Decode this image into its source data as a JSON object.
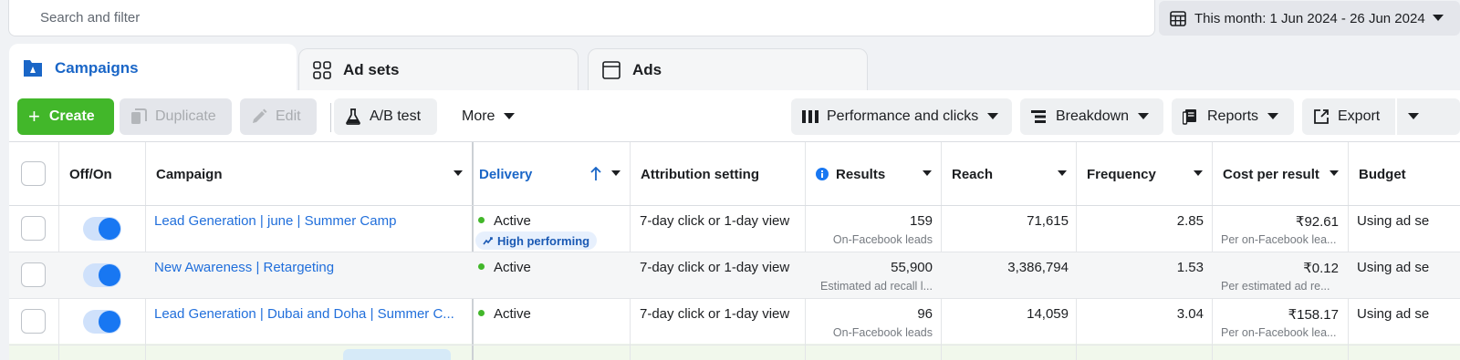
{
  "search": {
    "placeholder": "Search and filter"
  },
  "date_range": {
    "label": "This month: 1 Jun 2024 - 26 Jun 2024"
  },
  "tabs": [
    {
      "label": "Campaigns",
      "icon": "campaigns-icon",
      "active": true
    },
    {
      "label": "Ad sets",
      "icon": "ad-sets-icon",
      "active": false
    },
    {
      "label": "Ads",
      "icon": "ads-icon",
      "active": false
    }
  ],
  "toolbar": {
    "create": "Create",
    "duplicate": "Duplicate",
    "edit": "Edit",
    "ab_test": "A/B test",
    "more": "More",
    "performance": "Performance and clicks",
    "breakdown": "Breakdown",
    "reports": "Reports",
    "export": "Export"
  },
  "columns": {
    "off_on": "Off/On",
    "campaign": "Campaign",
    "delivery": "Delivery",
    "attribution": "Attribution setting",
    "results": "Results",
    "reach": "Reach",
    "frequency": "Frequency",
    "cost_per_result": "Cost per result",
    "budget": "Budget"
  },
  "rows": [
    {
      "campaign": "Lead Generation | june | Summer Camp",
      "delivery": "Active",
      "badge": "High performing",
      "attribution": "7-day click or 1-day view",
      "results": "159",
      "results_sub": "On-Facebook leads",
      "reach": "71,615",
      "frequency": "2.85",
      "cost": "₹92.61",
      "cost_sub": "Per on-Facebook lea...",
      "budget": "Using ad se"
    },
    {
      "campaign": "New Awareness | Retargeting",
      "delivery": "Active",
      "attribution": "7-day click or 1-day view",
      "results": "55,900",
      "results_sub": "Estimated ad recall l...",
      "reach": "3,386,794",
      "frequency": "1.53",
      "cost": "₹0.12",
      "cost_sub": "Per estimated ad re...",
      "budget": "Using ad se"
    },
    {
      "campaign": "Lead Generation | Dubai and Doha | Summer C...",
      "delivery": "Active",
      "attribution": "7-day click or 1-day view",
      "results": "96",
      "results_sub": "On-Facebook leads",
      "reach": "14,059",
      "frequency": "3.04",
      "cost": "₹158.17",
      "cost_sub": "Per on-Facebook lea...",
      "budget": "Using ad se"
    }
  ],
  "colors": {
    "accent_blue": "#1877f2",
    "link_blue": "#216fdb",
    "create_green": "#42b72a",
    "active_green": "#42b72a"
  }
}
